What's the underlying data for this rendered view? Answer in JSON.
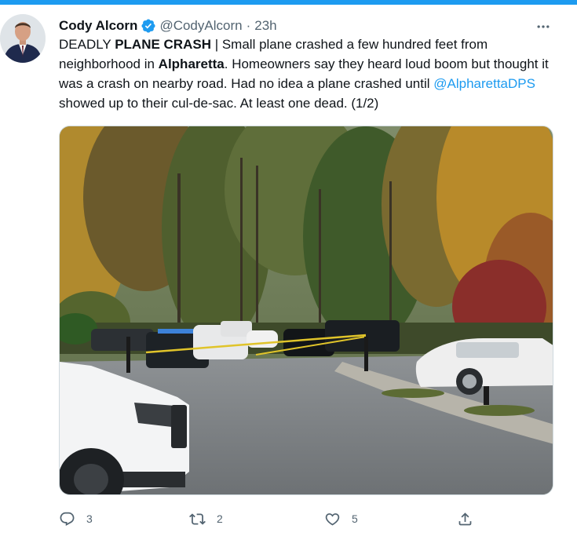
{
  "author": {
    "name": "Cody Alcorn",
    "handle": "@CodyAlcorn",
    "separator": "·",
    "time": "23h"
  },
  "tweet": {
    "text": {
      "p1": "DEADLY ",
      "p2": "PLANE CRASH",
      "p3": " | Small plane crashed a few hundred feet from neighborhood in ",
      "p4": "Alpharetta",
      "p5": ". Homeowners say they heard loud boom but thought it was a crash on nearby road. Had no idea a plane crashed until ",
      "mention": "@AlpharettaDPS",
      "p6": " showed up to their cul-de-sac. At least one dead. (1/2)"
    }
  },
  "actions": {
    "reply": {
      "icon": "reply-icon",
      "count": "3"
    },
    "retweet": {
      "icon": "retweet-icon",
      "count": "2"
    },
    "like": {
      "icon": "heart-icon",
      "count": "5"
    },
    "share": {
      "icon": "share-icon"
    }
  },
  "colors": {
    "accent": "#1d9bf0",
    "secondary_text": "#536471",
    "primary_text": "#0f1419"
  }
}
